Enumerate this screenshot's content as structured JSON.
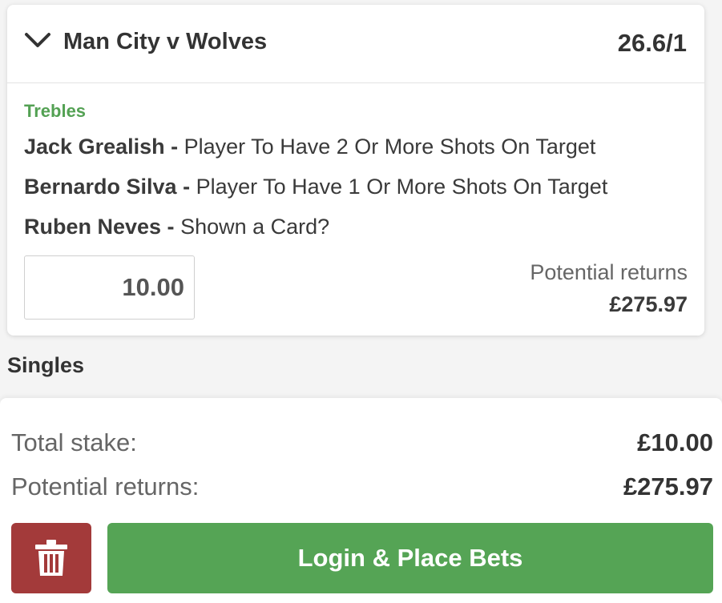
{
  "bet": {
    "match": "Man City v Wolves",
    "odds": "26.6/1",
    "bet_type": "Trebles",
    "selections": [
      {
        "player": "Jack Grealish -",
        "market": "Player To Have 2 Or More Shots On Target"
      },
      {
        "player": "Bernardo Silva -",
        "market": "Player To Have 1 Or More Shots On Target"
      },
      {
        "player": "Ruben Neves -",
        "market": "Shown a Card?"
      }
    ],
    "stake_value": "10.00",
    "potential_returns_label": "Potential returns",
    "potential_returns_value": "£275.97"
  },
  "singles": {
    "heading": "Singles"
  },
  "summary": {
    "total_stake_label": "Total stake:",
    "total_stake_value": "£10.00",
    "potential_returns_label": "Potential returns:",
    "potential_returns_value": "£275.97"
  },
  "actions": {
    "delete_icon": "trash-icon",
    "place_bets_label": "Login & Place Bets"
  },
  "colors": {
    "accent_green": "#55a455",
    "bet_type_green": "#53a153",
    "delete_red": "#a33a3a"
  }
}
